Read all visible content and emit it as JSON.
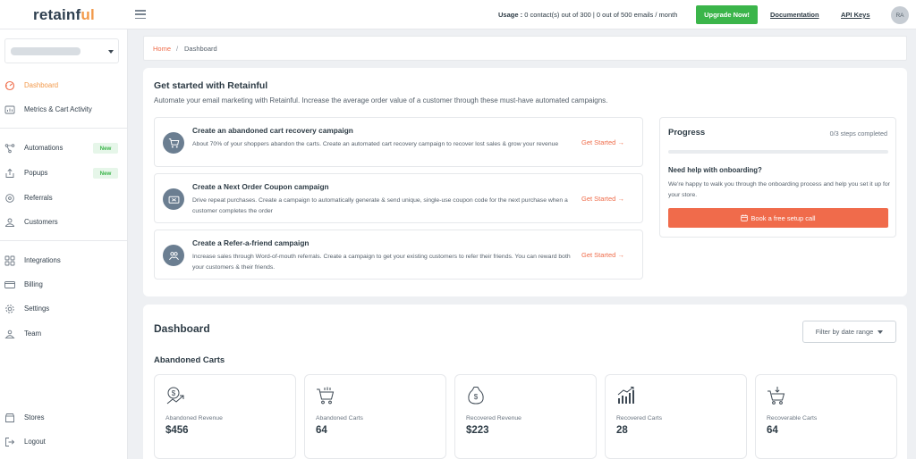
{
  "brand": {
    "name_main": "retainf",
    "name_accent": "ul",
    "accent_color": "#f2994a"
  },
  "header": {
    "usage_label": "Usage :",
    "usage_text": "0 contact(s) out of 300 | 0 out of 500 emails / month",
    "upgrade_label": "Upgrade Now!",
    "documentation_label": "Documentation",
    "api_keys_label": "API Keys",
    "avatar_initials": "RA"
  },
  "sidebar": {
    "items": [
      {
        "label": "Dashboard",
        "icon": "dashboard-gauge-icon",
        "active": true
      },
      {
        "label": "Metrics & Cart Activity",
        "icon": "metrics-icon"
      },
      {
        "label": "Automations",
        "icon": "automations-icon",
        "badge": "New"
      },
      {
        "label": "Popups",
        "icon": "popups-icon",
        "badge": "New"
      },
      {
        "label": "Referrals",
        "icon": "referrals-icon"
      },
      {
        "label": "Customers",
        "icon": "customers-icon"
      },
      {
        "label": "Integrations",
        "icon": "integrations-grid-icon"
      },
      {
        "label": "Billing",
        "icon": "billing-card-icon"
      },
      {
        "label": "Settings",
        "icon": "settings-gear-icon"
      },
      {
        "label": "Team",
        "icon": "team-icon"
      },
      {
        "label": "Stores",
        "icon": "stores-icon"
      },
      {
        "label": "Logout",
        "icon": "logout-icon"
      }
    ]
  },
  "breadcrumb": {
    "home": "Home",
    "separator": "/",
    "current": "Dashboard"
  },
  "get_started": {
    "title": "Get started with Retainful",
    "subtitle": "Automate your email marketing with Retainful. Increase the average order value of a customer through these must-have automated campaigns.",
    "campaigns": [
      {
        "title": "Create an abandoned cart recovery campaign",
        "description": "About 70% of your shoppers abandon the carts. Create an automated cart recovery campaign to recover lost sales & grow your revenue",
        "cta": "Get Started",
        "icon": "cart-icon"
      },
      {
        "title": "Create a Next Order Coupon campaign",
        "description": "Drive repeat purchases. Create a campaign to automatically generate & send unique, single-use coupon code for the next purchase when a customer completes the order",
        "cta": "Get Started",
        "icon": "coupon-icon"
      },
      {
        "title": "Create a Refer-a-friend campaign",
        "description": "Increase sales through Word-of-mouth referrals. Create a campaign to get your existing customers to refer their friends. You can reward both your customers & their friends.",
        "cta": "Get Started",
        "icon": "refer-friends-icon"
      }
    ],
    "progress": {
      "title": "Progress",
      "steps_text": "0/3 steps completed",
      "fraction": 0,
      "help_title": "Need help with onboarding?",
      "help_text": "We're happy to walk you through the onboarding process and help you set it up for your store.",
      "button_label": "Book a free setup call"
    }
  },
  "dashboard": {
    "title": "Dashboard",
    "filter_label": "Filter by date range",
    "section_title": "Abandoned Carts",
    "stats": [
      {
        "label": "Abandoned Revenue",
        "value": "$456",
        "icon": "dollar-trend-icon"
      },
      {
        "label": "Abandoned Carts",
        "value": "64",
        "icon": "cart-icon"
      },
      {
        "label": "Recovered Revenue",
        "value": "$223",
        "icon": "money-bag-icon"
      },
      {
        "label": "Recovered Carts",
        "value": "28",
        "icon": "bar-growth-icon"
      },
      {
        "label": "Recoverable Carts",
        "value": "64",
        "icon": "cart-down-icon"
      }
    ]
  }
}
